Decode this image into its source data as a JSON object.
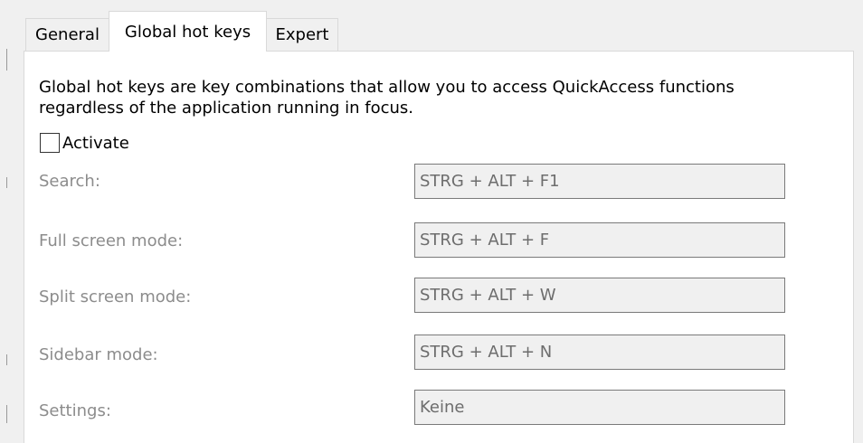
{
  "tabs": {
    "general": "General",
    "global_hot_keys": "Global hot keys",
    "expert": "Expert"
  },
  "description": "Global hot keys are key combinations that allow you to access QuickAccess functions regardless of the application running in focus.",
  "activate": {
    "label": "Activate",
    "checked": false
  },
  "hotkeys": [
    {
      "label": "Search:",
      "value": "STRG + ALT + F1"
    },
    {
      "label": "Full screen mode:",
      "value": "STRG + ALT + F"
    },
    {
      "label": "Split screen mode:",
      "value": "STRG + ALT + W"
    },
    {
      "label": "Sidebar mode:",
      "value": "STRG + ALT + N"
    },
    {
      "label": "Settings:",
      "value": "Keine"
    }
  ],
  "colors": {
    "panel_background": "#ffffff",
    "window_background": "#f0f0f0",
    "disabled_text": "#8c8c8c",
    "field_border": "#7a7a7a"
  }
}
